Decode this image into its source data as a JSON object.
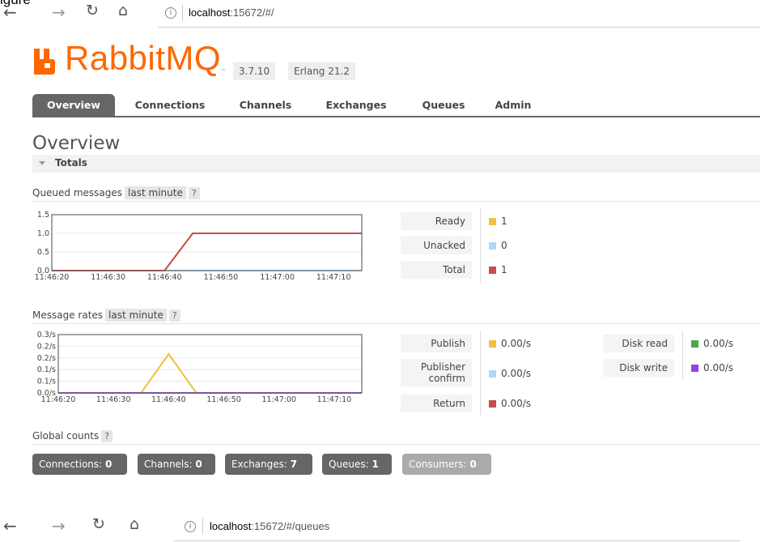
{
  "top_fragment": "igure",
  "browser1": {
    "url_host": "localhost",
    "url_rest": ":15672/#/"
  },
  "browser2": {
    "url_host": "localhost",
    "url_rest": ":15672/#/queues"
  },
  "nav_glyphs": {
    "back": "←",
    "forward": "→",
    "reload": "↻",
    "home": "⌂",
    "info": "i"
  },
  "logo": {
    "text_a": "Rabbit",
    "text_b": "MQ",
    "tm": "™"
  },
  "versions": [
    "3.7.10",
    "Erlang 21.2"
  ],
  "tabs": [
    "Overview",
    "Connections",
    "Channels",
    "Exchanges",
    "Queues",
    "Admin"
  ],
  "active_tab": "Overview",
  "page_title": "Overview",
  "totals_label": "Totals",
  "queued": {
    "label": "Queued messages",
    "range": "last minute",
    "help": "?",
    "legend": [
      {
        "label": "Ready",
        "value": "1",
        "color": "#edc240"
      },
      {
        "label": "Unacked",
        "value": "0",
        "color": "#afd8f8"
      },
      {
        "label": "Total",
        "value": "1",
        "color": "#cb4b4b"
      }
    ]
  },
  "rates": {
    "label": "Message rates",
    "range": "last minute",
    "help": "?",
    "legend_left": [
      {
        "label": "Publish",
        "value": "0.00/s",
        "color": "#edc240"
      },
      {
        "label_lines": [
          "Publisher",
          "confirm"
        ],
        "value": "0.00/s",
        "color": "#afd8f8"
      },
      {
        "label": "Return",
        "value": "0.00/s",
        "color": "#cb4b4b"
      }
    ],
    "legend_right": [
      {
        "label": "Disk read",
        "value": "0.00/s",
        "color": "#4da74d"
      },
      {
        "label": "Disk write",
        "value": "0.00/s",
        "color": "#9440ed"
      }
    ]
  },
  "global": {
    "label": "Global counts",
    "help": "?",
    "counters": [
      {
        "label": "Connections:",
        "value": "0"
      },
      {
        "label": "Channels:",
        "value": "0"
      },
      {
        "label": "Exchanges:",
        "value": "7"
      },
      {
        "label": "Queues:",
        "value": "1"
      },
      {
        "label": "Consumers:",
        "value": "0"
      }
    ]
  },
  "chart_data": [
    {
      "type": "line",
      "name": "Queued messages",
      "x": [
        "11:46:20",
        "11:46:30",
        "11:46:40",
        "11:46:50",
        "11:47:00",
        "11:47:10"
      ],
      "y_ticks": [
        "0.0",
        "0.5",
        "1.0",
        "1.5"
      ],
      "ylim": [
        0,
        1.5
      ],
      "xlim_seconds": [
        0,
        55
      ],
      "series": [
        {
          "name": "Ready",
          "color": "#edc240",
          "points": [
            [
              0,
              0
            ],
            [
              20,
              0
            ],
            [
              25,
              1
            ],
            [
              55,
              1
            ]
          ]
        },
        {
          "name": "Unacked",
          "color": "#afd8f8",
          "points": [
            [
              0,
              0
            ],
            [
              55,
              0
            ]
          ]
        },
        {
          "name": "Total",
          "color": "#cb4b4b",
          "points": [
            [
              0,
              0
            ],
            [
              20,
              0
            ],
            [
              25,
              1
            ],
            [
              55,
              1
            ]
          ]
        }
      ]
    },
    {
      "type": "line",
      "name": "Message rates",
      "x": [
        "11:46:20",
        "11:46:30",
        "11:46:40",
        "11:46:50",
        "11:47:00",
        "11:47:10"
      ],
      "y_ticks": [
        "0.0/s",
        "0.1/s",
        "0.1/s",
        "0.2/s",
        "0.2/s",
        "0.3/s"
      ],
      "ylim": [
        0,
        0.3
      ],
      "xlim_seconds": [
        0,
        55
      ],
      "series": [
        {
          "name": "Publish",
          "color": "#edc240",
          "points": [
            [
              0,
              0
            ],
            [
              15,
              0
            ],
            [
              20,
              0.2
            ],
            [
              25,
              0
            ],
            [
              55,
              0
            ]
          ]
        },
        {
          "name": "Publisher confirm",
          "color": "#afd8f8",
          "points": [
            [
              0,
              0
            ],
            [
              55,
              0
            ]
          ]
        },
        {
          "name": "Return",
          "color": "#cb4b4b",
          "points": [
            [
              0,
              0
            ],
            [
              55,
              0
            ]
          ]
        },
        {
          "name": "Disk read",
          "color": "#4da74d",
          "points": [
            [
              0,
              0
            ],
            [
              55,
              0
            ]
          ]
        },
        {
          "name": "Disk write",
          "color": "#9440ed",
          "points": [
            [
              0,
              0
            ],
            [
              55,
              0
            ]
          ]
        }
      ]
    }
  ]
}
